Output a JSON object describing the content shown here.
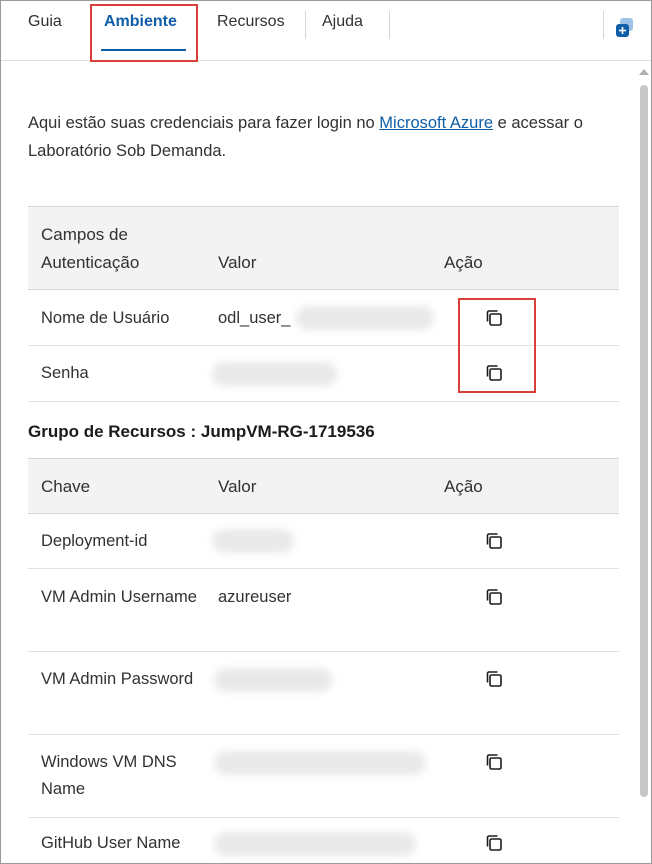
{
  "tabs": [
    {
      "label": "Guia"
    },
    {
      "label": "Ambiente"
    },
    {
      "label": "Recursos"
    },
    {
      "label": "Ajuda"
    }
  ],
  "intro": {
    "before": "Aqui estão suas credenciais para fazer login no ",
    "link": "Microsoft Azure",
    "after": " e acessar o Laboratório Sob Demanda."
  },
  "auth_table": {
    "headers": {
      "field": "Campos de Autenticação",
      "value": "Valor",
      "action": "Ação"
    },
    "rows": [
      {
        "key": "Nome de Usuário",
        "value": "odl_user_"
      },
      {
        "key": "Senha",
        "value": ""
      }
    ]
  },
  "resource_group": {
    "title": "Grupo de Recursos : JumpVM-RG-1719536"
  },
  "resource_table": {
    "headers": {
      "key": "Chave",
      "value": "Valor",
      "action": "Ação"
    },
    "rows": [
      {
        "key": "Deployment-id",
        "value": ""
      },
      {
        "key": "VM Admin Username",
        "value": "azureuser"
      },
      {
        "key": "VM Admin Password",
        "value": ""
      },
      {
        "key": "Windows VM DNS Name",
        "value": ""
      },
      {
        "key": "GitHub User Name",
        "value": ""
      }
    ]
  },
  "colors": {
    "accent": "#0f5ea8",
    "highlight": "#d9403a"
  },
  "icons": {
    "copy": "copy-icon",
    "app": "app-launcher-icon"
  }
}
